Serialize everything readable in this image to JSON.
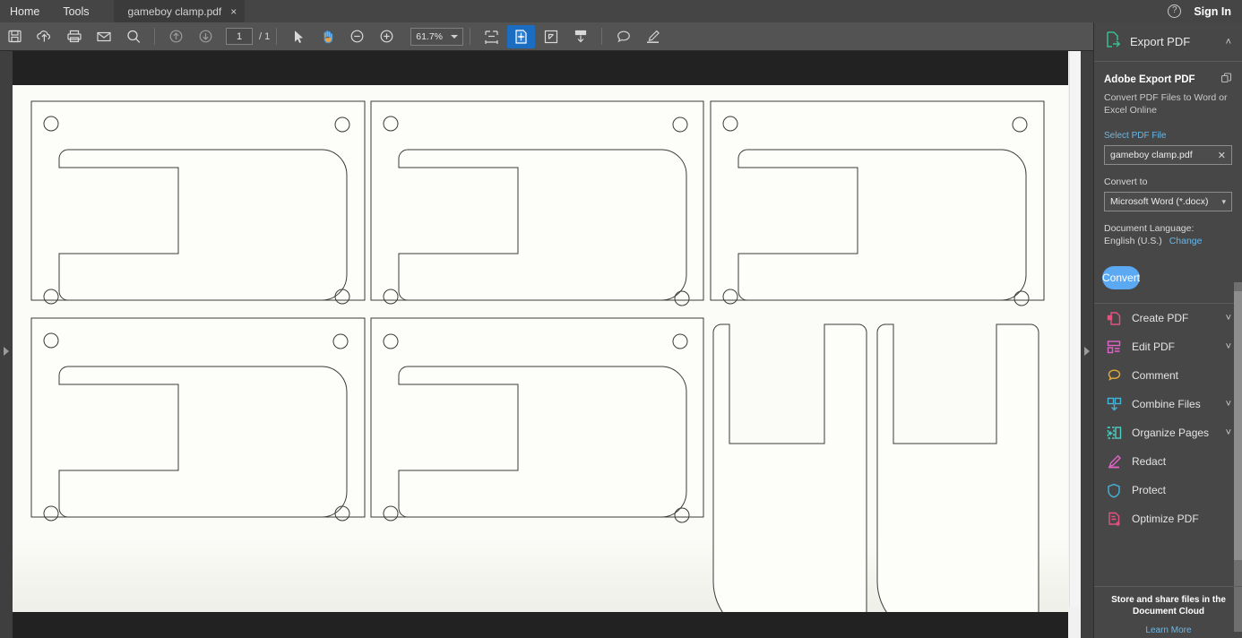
{
  "titlebar": {
    "menus": [
      "Home",
      "Tools"
    ],
    "tab": {
      "name": "gameboy clamp.pdf",
      "close": "×"
    },
    "help_icon": "?",
    "signin": "Sign In"
  },
  "toolbar": {
    "icons": [
      "save-icon",
      "upload-cloud-icon",
      "print-icon",
      "email-icon",
      "search-icon",
      "previous-page-icon",
      "next-page-icon"
    ],
    "page_current": "1",
    "page_total": "/ 1",
    "select_tool": "select-cursor-icon",
    "hand_tool": "hand-icon",
    "zoom_out": "zoom-out-icon",
    "zoom_in": "zoom-in-icon",
    "zoom_level": "61.7%",
    "right_icons": [
      "fit-width-icon",
      "page-thumbnail-icon",
      "fit-page-icon",
      "scroll-down-icon",
      "comment-icon",
      "highlight-icon"
    ]
  },
  "sidebar": {
    "header": {
      "label": "Export PDF",
      "icon": "export-pdf-icon",
      "chevron": "˄"
    },
    "panel": {
      "title": "Adobe Export PDF",
      "copy_icon": "copy-icon",
      "subtitle": "Convert PDF Files to Word or Excel Online",
      "select_file_label": "Select PDF File",
      "file_value": "gameboy clamp.pdf",
      "file_clear": "✕",
      "convert_to_label": "Convert to",
      "convert_to_value": "Microsoft Word (*.docx)",
      "doc_language_label": "Document Language:",
      "doc_language_value": "English (U.S.)",
      "doc_language_change": "Change",
      "convert_button": "Convert"
    },
    "tools": [
      {
        "label": "Create PDF",
        "icon": "create-pdf-icon",
        "color": "#e2537f",
        "chevron": "˅"
      },
      {
        "label": "Edit PDF",
        "icon": "edit-pdf-icon",
        "color": "#e064c8",
        "chevron": "˅"
      },
      {
        "label": "Comment",
        "icon": "comment-icon",
        "color": "#e0a83c",
        "chevron": ""
      },
      {
        "label": "Combine Files",
        "icon": "combine-files-icon",
        "color": "#46b5d8",
        "chevron": "˅"
      },
      {
        "label": "Organize Pages",
        "icon": "organize-pages-icon",
        "color": "#4fd0c4",
        "chevron": "˅"
      },
      {
        "label": "Redact",
        "icon": "redact-icon",
        "color": "#e064c8",
        "chevron": ""
      },
      {
        "label": "Protect",
        "icon": "protect-icon",
        "color": "#46b5d8",
        "chevron": ""
      },
      {
        "label": "Optimize PDF",
        "icon": "optimize-pdf-icon",
        "color": "#e2537f",
        "chevron": ""
      }
    ],
    "footer": {
      "title": "Store and share files in the Document Cloud",
      "link": "Learn More"
    }
  },
  "document": {
    "parts": [
      {
        "type": "clamp-plate",
        "col": 0,
        "row": 0
      },
      {
        "type": "clamp-plate",
        "col": 1,
        "row": 0
      },
      {
        "type": "clamp-plate",
        "col": 2,
        "row": 0
      },
      {
        "type": "clamp-plate",
        "col": 0,
        "row": 1
      },
      {
        "type": "clamp-plate",
        "col": 1,
        "row": 1
      },
      {
        "type": "fork-part",
        "col": 2,
        "row": 1
      },
      {
        "type": "fork-part",
        "col": 3,
        "row": 1
      }
    ],
    "stroke_color": "#333333",
    "page_color": "#fbfbf7"
  }
}
